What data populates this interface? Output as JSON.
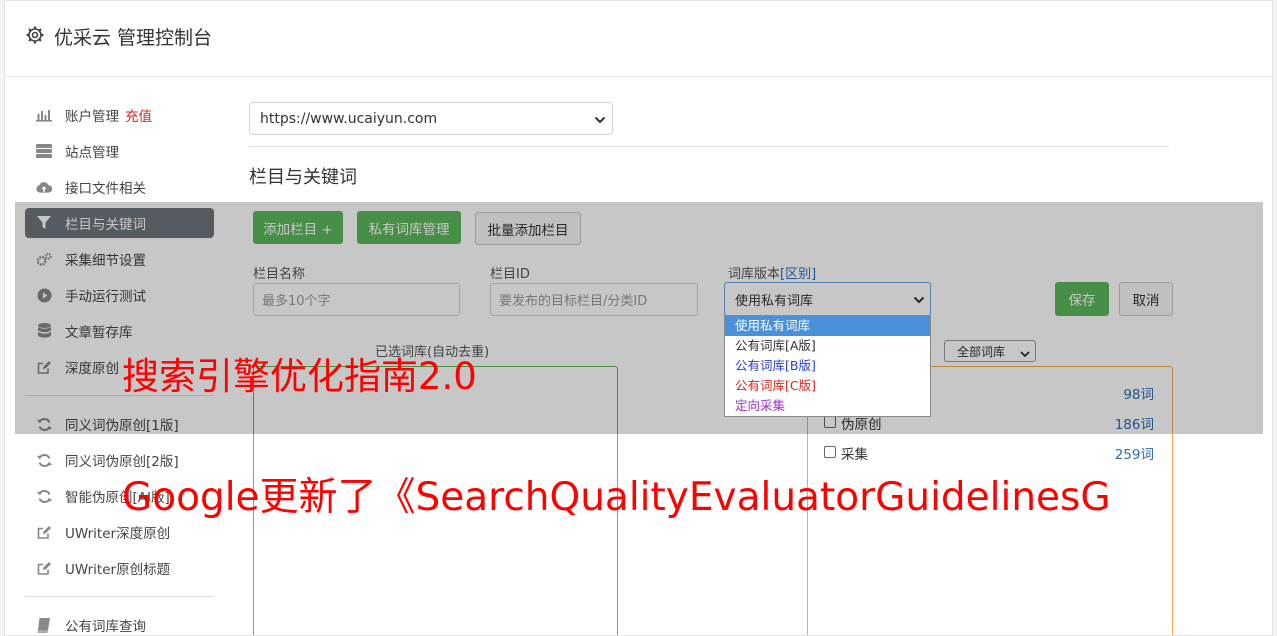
{
  "header": {
    "title": "优采云 管理控制台",
    "icon": "gear-icon"
  },
  "sidebar": {
    "items": [
      {
        "label": "账户管理",
        "badge": "充值",
        "icon": "bar-chart-icon"
      },
      {
        "label": "站点管理",
        "icon": "server-icon"
      },
      {
        "label": "接口文件相关",
        "icon": "cloud-upload-icon"
      },
      {
        "label": "栏目与关键词",
        "icon": "filter-icon",
        "active": true
      },
      {
        "label": "采集细节设置",
        "icon": "cogs-icon"
      },
      {
        "label": "手动运行测试",
        "icon": "play-circle-icon"
      },
      {
        "label": "文章暂存库",
        "icon": "database-icon"
      },
      {
        "label": "深度原创",
        "icon": "edit-icon"
      },
      {
        "label": "同义词伪原创[1版]",
        "icon": "refresh-icon"
      },
      {
        "label": "同义词伪原创[2版]",
        "icon": "refresh-icon"
      },
      {
        "label": "智能伪原创[AI版]",
        "icon": "refresh-icon"
      },
      {
        "label": "UWriter深度原创",
        "icon": "edit-icon"
      },
      {
        "label": "UWriter原创标题",
        "icon": "edit-icon"
      },
      {
        "label": "公有词库查询",
        "icon": "book-icon"
      }
    ]
  },
  "main": {
    "site_select": "https://www.ucaiyun.com",
    "section_title": "栏目与关键词",
    "buttons": {
      "add_column": "添加栏目 +",
      "private_lib": "私有词库管理",
      "batch_add": "批量添加栏目",
      "save": "保存",
      "cancel": "取消"
    },
    "form": {
      "name_label": "栏目名称",
      "name_placeholder": "最多10个字",
      "id_label": "栏目ID",
      "id_placeholder": "要发布的目标栏目/分类ID",
      "version_label": "词库版本",
      "version_link": "[区别]",
      "version_value": "使用私有词库",
      "version_options": [
        "使用私有词库",
        "公有词库[A版]",
        "公有词库[B版]",
        "公有词库[C版]",
        "定向采集"
      ]
    },
    "selected_title": "已选词库(自动去重)",
    "lib_filter": "全部词库",
    "libs": [
      {
        "name": "",
        "count": "98词"
      },
      {
        "name": "伪原创",
        "count": "186词"
      },
      {
        "name": "采集",
        "count": "259词"
      }
    ]
  },
  "watermarks": {
    "line1": "搜索引擎优化指南2.0",
    "line2": "Google更新了《SearchQualityEvaluatorGuidelinesG"
  },
  "colors": {
    "green": "#5cb85c",
    "active_nav": "#6c757d",
    "red": "#d9261c",
    "blue": "#2b6cb8",
    "orange": "#f0ad4e",
    "option_b": "#2b3bd6",
    "option_c": "#d9261c",
    "option_dir": "#9b2fd0"
  }
}
